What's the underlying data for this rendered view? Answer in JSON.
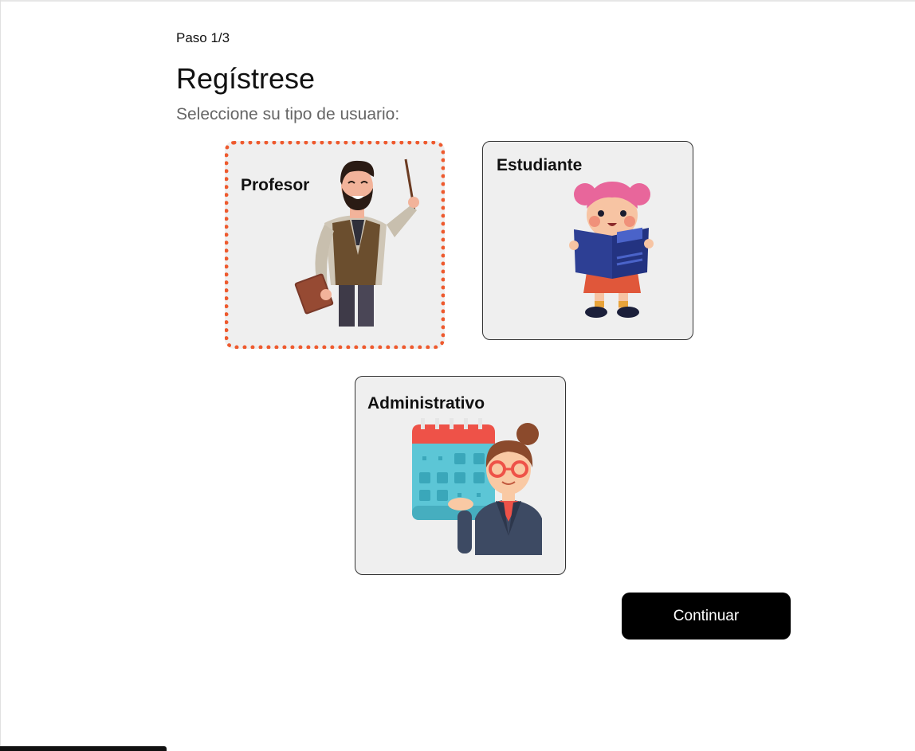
{
  "header": {
    "step": "Paso 1/3",
    "title": "Regístrese",
    "subtitle": "Seleccione su tipo de usuario:"
  },
  "options": [
    {
      "label": "Profesor",
      "icon": "teacher-illustration",
      "selected": true
    },
    {
      "label": "Estudiante",
      "icon": "student-illustration",
      "selected": false
    },
    {
      "label": "Administrativo",
      "icon": "administrative-illustration",
      "selected": false
    }
  ],
  "actions": {
    "continue_label": "Continuar"
  },
  "colors": {
    "selected_border": "#ee5a2e",
    "card_bg": "#efefef",
    "button_bg": "#000000"
  }
}
